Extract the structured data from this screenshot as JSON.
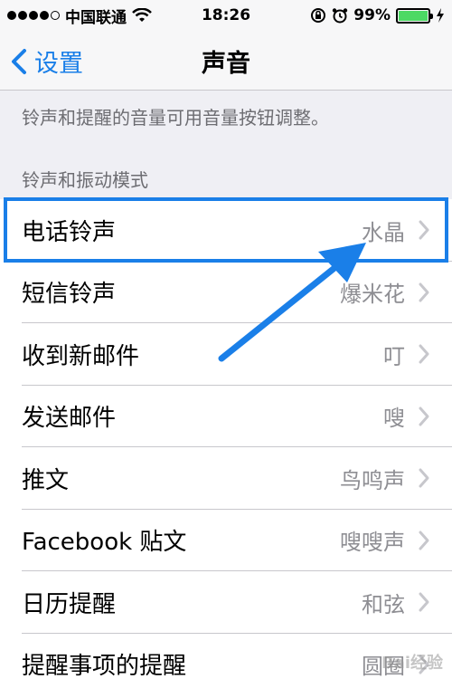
{
  "status_bar": {
    "carrier": "中国联通",
    "time": "18:26",
    "battery_percent": "99%",
    "battery_level": 0.99,
    "signal_bars_on": 4,
    "signal_bars_total": 5
  },
  "nav": {
    "back_label": "设置",
    "title": "声音"
  },
  "note": "铃声和提醒的音量可用音量按钮调整。",
  "section_header": "铃声和振动模式",
  "rows": [
    {
      "label": "电话铃声",
      "value": "水晶"
    },
    {
      "label": "短信铃声",
      "value": "爆米花"
    },
    {
      "label": "收到新邮件",
      "value": "叮"
    },
    {
      "label": "发送邮件",
      "value": "嗖"
    },
    {
      "label": "推文",
      "value": "鸟鸣声"
    },
    {
      "label": "Facebook 贴文",
      "value": "嗖嗖声"
    },
    {
      "label": "日历提醒",
      "value": "和弦"
    },
    {
      "label": "提醒事项的提醒",
      "value": "圆圈"
    }
  ],
  "colors": {
    "accent": "#1a7fe8",
    "battery": "#4cd964",
    "annotation_arrow": "#1a7fe8"
  },
  "watermark": "Bai经验"
}
